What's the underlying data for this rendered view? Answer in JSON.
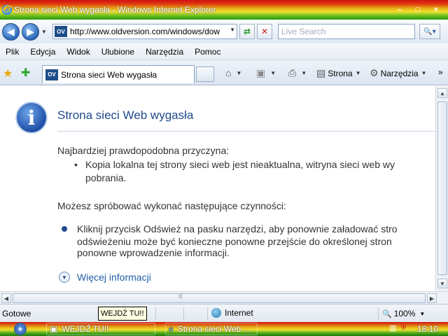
{
  "window": {
    "title": "Strona sieci Web wygasła - Windows Internet Explorer",
    "min": "–",
    "max": "□",
    "close": "×"
  },
  "address": {
    "url": "http://www.oldversion.com/windows/dow",
    "badge": "OV",
    "search_placeholder": "Live Search"
  },
  "menu": [
    "Plik",
    "Edycja",
    "Widok",
    "Ulubione",
    "Narzędzia",
    "Pomoc"
  ],
  "tab": {
    "label": "Strona sieci Web wygasła",
    "badge": "OV"
  },
  "commands": {
    "page": "Strona",
    "tools": "Narzędzia",
    "more": "»"
  },
  "content": {
    "heading": "Strona sieci Web wygasła",
    "cause_label": "Najbardziej prawdopodobna przyczyna:",
    "cause_line1": "Kopia lokalna tej strony sieci web jest nieaktualna, witryna sieci web wy",
    "cause_line2": "pobrania.",
    "try_label": "Możesz spróbować wykonać następujące czynności:",
    "try_line1": "Kliknij przycisk Odśwież na pasku narzędzi, aby ponownie załadować stro",
    "try_line2": "odświeżeniu może być konieczne ponowne przejście do określonej stron",
    "try_line3": "ponowne wprowadzenie informacji.",
    "more_info": "Więcej informacji"
  },
  "status": {
    "ready": "Gotowe",
    "tooltip": "WEJDŹ TU!!",
    "zone": "Internet",
    "zoom": "100%"
  },
  "taskbar": {
    "item1": "WEJDŹ TU!!",
    "item2": "Strona sieci Web ...",
    "clock": "18:10"
  }
}
